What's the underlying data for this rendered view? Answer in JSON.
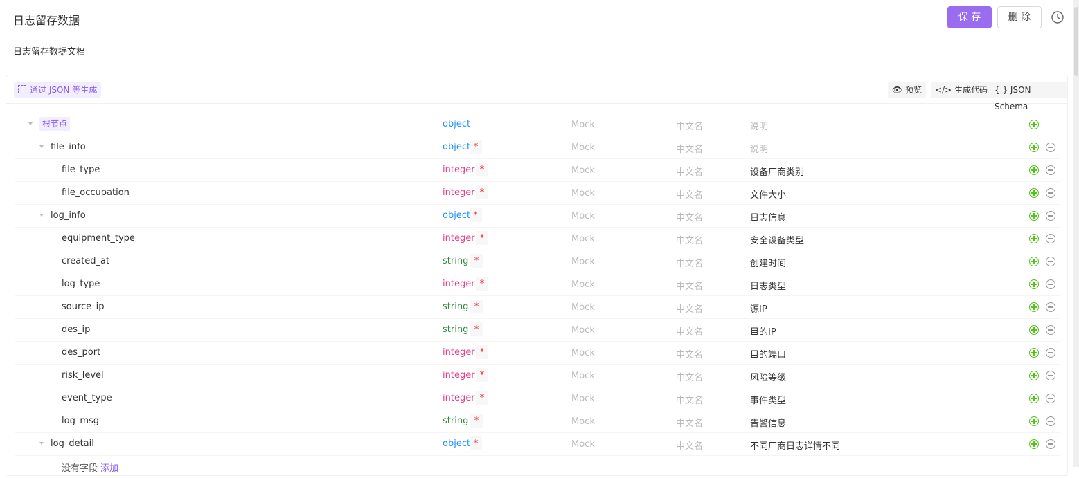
{
  "header": {
    "title": "日志留存数据",
    "save_label": "保 存",
    "delete_label": "删 除",
    "description": "日志留存数据文档"
  },
  "toolbar": {
    "gen_json_label": "通过 JSON 等生成",
    "preview_label": "预览",
    "gen_code_label": "生成代码",
    "json_schema_label": "JSON Schema"
  },
  "tree": {
    "root": {
      "label": "根节点",
      "type": "object",
      "mock": "Mock",
      "cn": "中文名",
      "desc": "说明"
    },
    "rows": [
      {
        "name": "file_info",
        "type": "object",
        "req": "*",
        "mock": "Mock",
        "cn": "中文名",
        "desc": "说明"
      },
      {
        "name": "file_type",
        "type": "integer",
        "req": "*",
        "mock": "Mock",
        "cn": "中文名",
        "desc": "设备厂商类别"
      },
      {
        "name": "file_occupation",
        "type": "integer",
        "req": "*",
        "mock": "Mock",
        "cn": "中文名",
        "desc": "文件大小"
      },
      {
        "name": "log_info",
        "type": "object",
        "req": "*",
        "mock": "Mock",
        "cn": "中文名",
        "desc": "日志信息"
      },
      {
        "name": "equipment_type",
        "type": "integer",
        "req": "*",
        "mock": "Mock",
        "cn": "中文名",
        "desc": "安全设备类型"
      },
      {
        "name": "created_at",
        "type": "string",
        "req": "*",
        "mock": "Mock",
        "cn": "中文名",
        "desc": "创建时间"
      },
      {
        "name": "log_type",
        "type": "integer",
        "req": "*",
        "mock": "Mock",
        "cn": "中文名",
        "desc": "日志类型"
      },
      {
        "name": "source_ip",
        "type": "string",
        "req": "*",
        "mock": "Mock",
        "cn": "中文名",
        "desc": "源IP"
      },
      {
        "name": "des_ip",
        "type": "string",
        "req": "*",
        "mock": "Mock",
        "cn": "中文名",
        "desc": "目的IP"
      },
      {
        "name": "des_port",
        "type": "integer",
        "req": "*",
        "mock": "Mock",
        "cn": "中文名",
        "desc": "目的端口"
      },
      {
        "name": "risk_level",
        "type": "integer",
        "req": "*",
        "mock": "Mock",
        "cn": "中文名",
        "desc": "风险等级"
      },
      {
        "name": "event_type",
        "type": "integer",
        "req": "*",
        "mock": "Mock",
        "cn": "中文名",
        "desc": "事件类型"
      },
      {
        "name": "log_msg",
        "type": "string",
        "req": "*",
        "mock": "Mock",
        "cn": "中文名",
        "desc": "告警信息"
      },
      {
        "name": "log_detail",
        "type": "object",
        "req": "*",
        "mock": "Mock",
        "cn": "中文名",
        "desc": "不同厂商日志详情不同"
      }
    ],
    "empty_text": "没有字段",
    "empty_add": "添加"
  },
  "icons": [
    "history-icon",
    "eye-icon",
    "code-icon",
    "braces-icon",
    "scan-icon",
    "caret-down-icon",
    "add-icon",
    "remove-icon"
  ]
}
